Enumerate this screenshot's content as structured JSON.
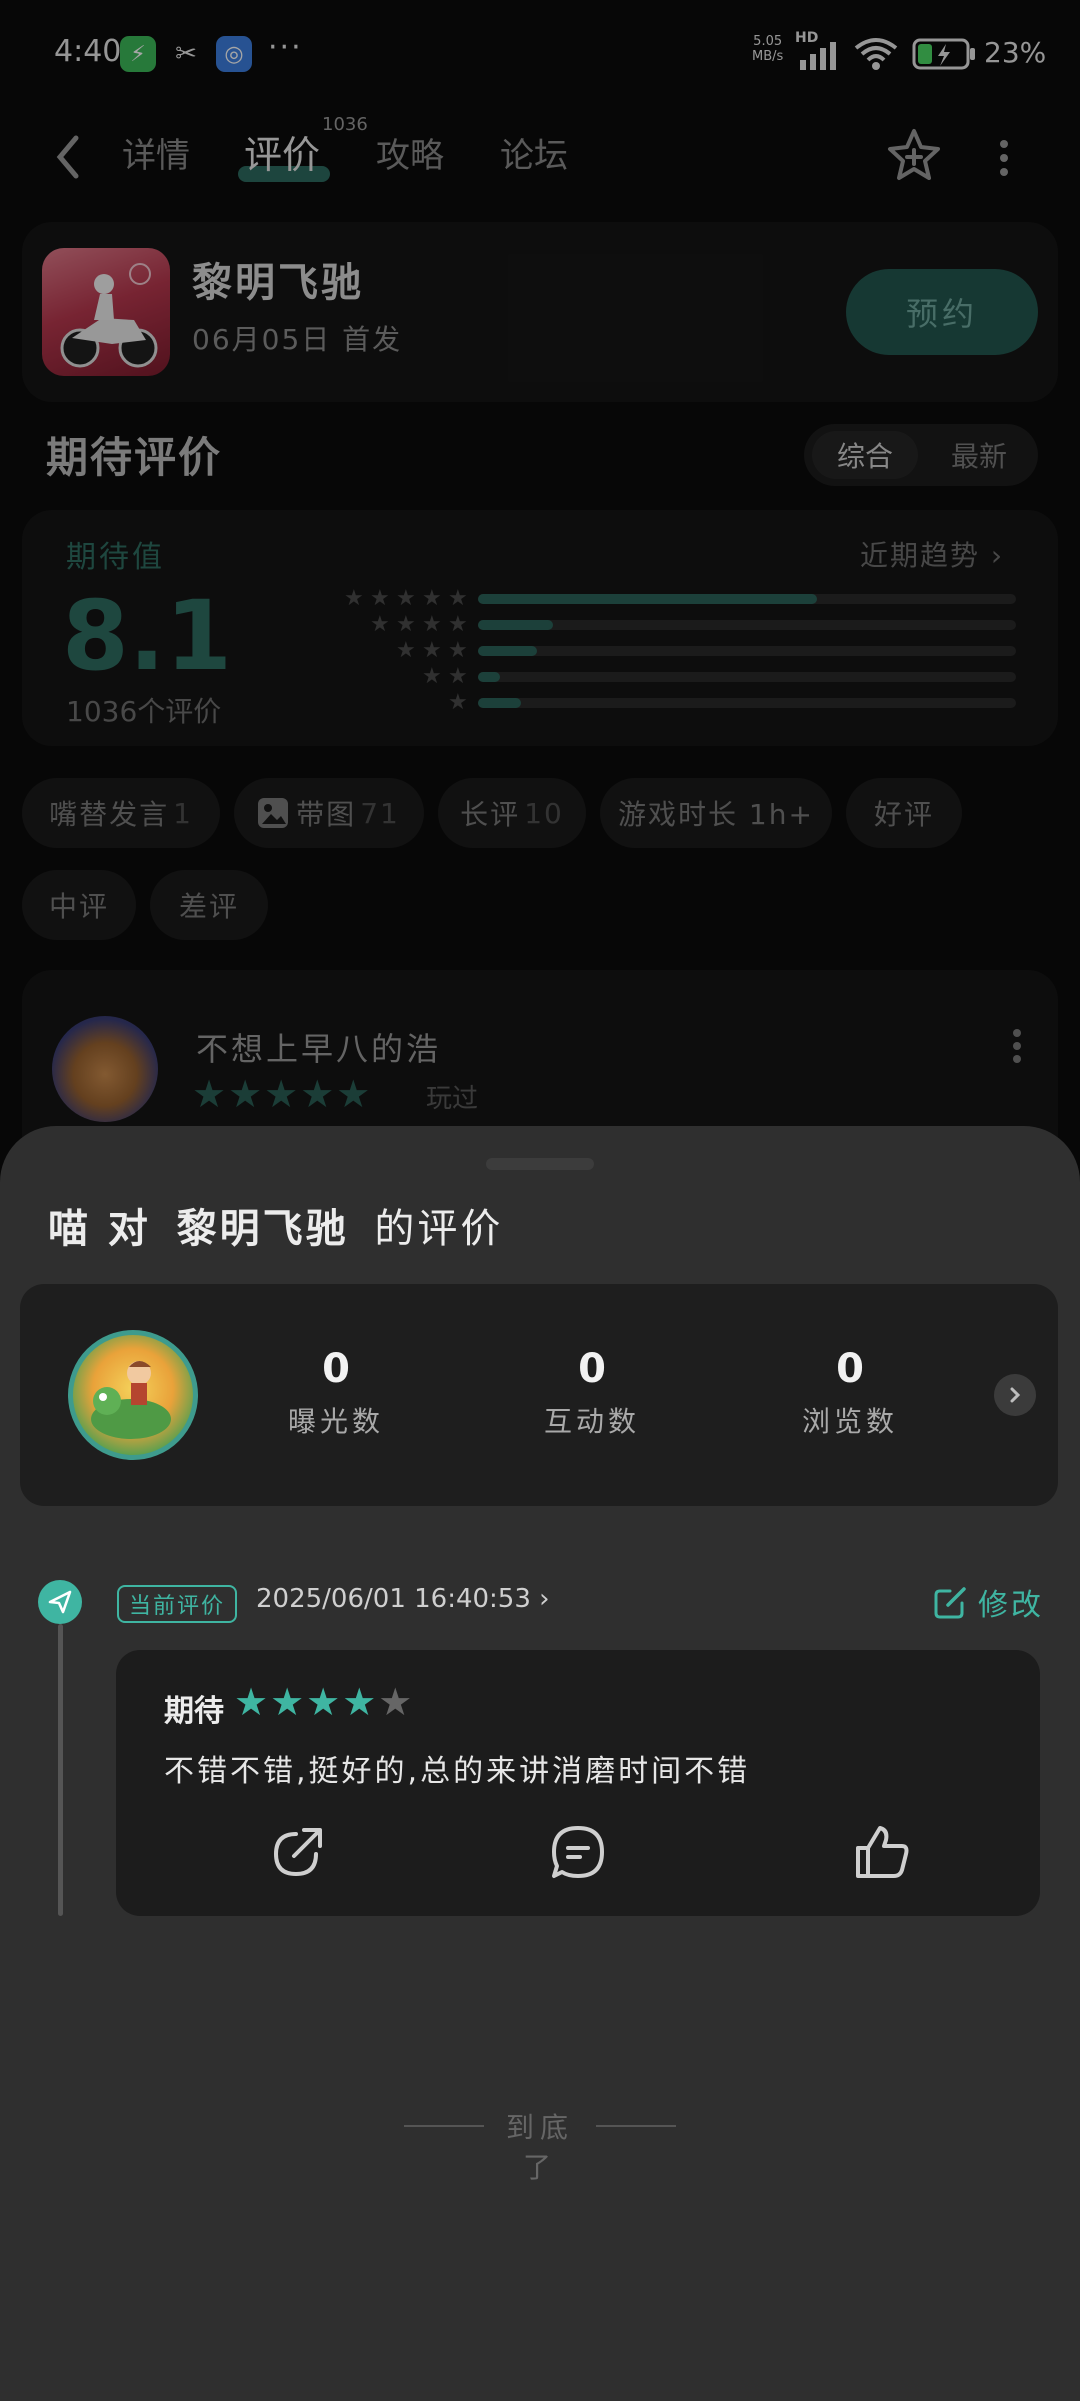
{
  "status_bar": {
    "time": "4:40",
    "more": "···",
    "net_speed_value": "5.05",
    "net_speed_unit": "MB/s",
    "hd": "HD",
    "battery": "23%"
  },
  "nav": {
    "tabs": [
      {
        "label": "详情"
      },
      {
        "label": "评价"
      },
      {
        "label": "攻略"
      },
      {
        "label": "论坛"
      }
    ],
    "active_tab_count": "1036"
  },
  "game": {
    "title": "黎明飞驰",
    "release": "06月05日 首发",
    "reserve_label": "预约"
  },
  "expectation": {
    "section_title": "期待评价",
    "sort": {
      "active": "综合",
      "other": "最新"
    },
    "label": "期待值",
    "score": "8.1",
    "count_text": "1036个评价",
    "trend_link": "近期趋势",
    "distribution": [
      {
        "stars": 5,
        "fraction": 0.63
      },
      {
        "stars": 4,
        "fraction": 0.14
      },
      {
        "stars": 3,
        "fraction": 0.11
      },
      {
        "stars": 2,
        "fraction": 0.04
      },
      {
        "stars": 1,
        "fraction": 0.08
      }
    ]
  },
  "filters": [
    {
      "label": "嘴替发言",
      "count": "1"
    },
    {
      "label": "带图",
      "count": "71"
    },
    {
      "label": "长评",
      "count": "10"
    },
    {
      "label": "游戏时长 1h+",
      "count": ""
    },
    {
      "label": "好评",
      "count": ""
    },
    {
      "label": "中评",
      "count": ""
    },
    {
      "label": "差评",
      "count": ""
    }
  ],
  "preview_review": {
    "user": "不想上早八的浩",
    "stars": 5,
    "played": "玩过"
  },
  "sheet": {
    "title_prefix": "喵 对",
    "title_game": "黎明飞驰",
    "title_suffix": "的评价",
    "stats": [
      {
        "value": "0",
        "label": "曝光数"
      },
      {
        "value": "0",
        "label": "互动数"
      },
      {
        "value": "0",
        "label": "浏览数"
      }
    ],
    "current_badge": "当前评价",
    "current_time": "2025/06/01 16:40:53",
    "edit_label": "修改",
    "review": {
      "label": "期待",
      "stars_on": 4,
      "stars_total": 5,
      "text": "不错不错,挺好的,总的来讲消磨时间不错"
    },
    "end_text": "到底了"
  },
  "colors": {
    "accent": "#3fb5a2",
    "accent_dark": "#2f6d62",
    "sheet_bg": "#2f2f2f",
    "card_bg": "#151515"
  },
  "icons": [
    "back-icon",
    "star-add-icon",
    "more-vertical-icon",
    "chevron-right-icon",
    "image-icon",
    "send-icon",
    "edit-icon",
    "share-icon",
    "comment-icon",
    "like-icon"
  ]
}
